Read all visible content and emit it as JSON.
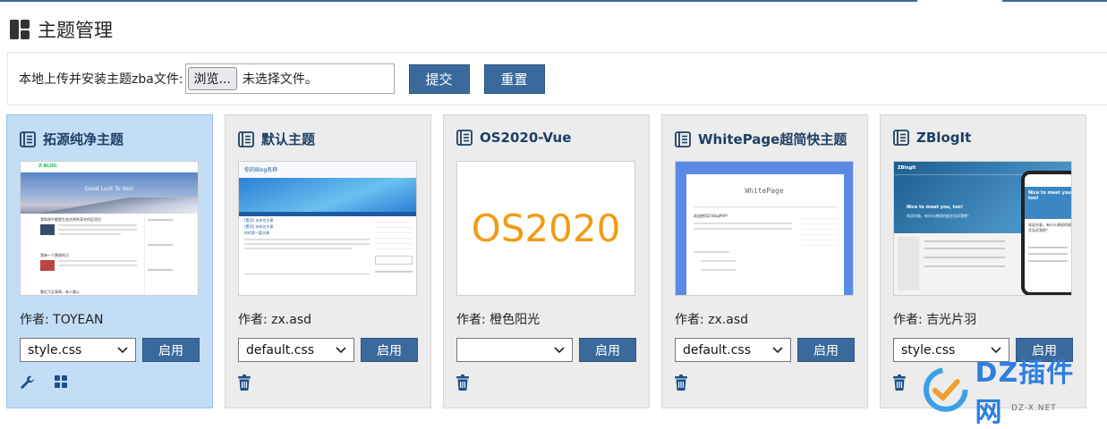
{
  "header": {
    "title": "主题管理",
    "icon": "layout-icon"
  },
  "upload": {
    "label": "本地上传并安装主题zba文件:",
    "browse_label": "浏览...",
    "file_status": "未选择文件。",
    "submit_label": "提交",
    "reset_label": "重置"
  },
  "colors": {
    "accent": "#3a6a9c",
    "active_card": "#c3ddf6",
    "card_bg": "#ececec"
  },
  "themes": [
    {
      "name": "拓源纯净主题",
      "author_prefix": "作者:",
      "author": "TOYEAN",
      "style": "style.css",
      "enable_label": "启用",
      "active": true,
      "preview": {
        "logo": "Z-BLOG",
        "banner": "Good Luck To You!",
        "post1": "我和南平都是生态文明共享合作区项目",
        "post2": "我每一个黄昏的日",
        "post3": "靠近乃至高原，有人路心"
      }
    },
    {
      "name": "默认主题",
      "author_prefix": "作者:",
      "author": "zx.asd",
      "style": "default.css",
      "enable_label": "启用",
      "active": false,
      "preview": {
        "site_title": "你的Blog名称",
        "post1": "[置顶] 未命名文章",
        "post2": "[置顶] 未命名文章",
        "post3": "你的第一篇文章"
      }
    },
    {
      "name": "OS2020-Vue",
      "author_prefix": "作者:",
      "author": "橙色阳光",
      "style": "",
      "enable_label": "启用",
      "active": false,
      "preview": {
        "logo_text": "OS2020"
      }
    },
    {
      "name": "WhitePage超简快主题",
      "author_prefix": "作者:",
      "author": "zx.asd",
      "style": "default.css",
      "enable_label": "启用",
      "active": false,
      "preview": {
        "site_title": "WhitePage",
        "post1": "欢迎使用Z-BlogPHP!"
      }
    },
    {
      "name": "ZBlogIt",
      "author_prefix": "作者:",
      "author": "吉光片羽",
      "style": "style.css",
      "enable_label": "启用",
      "active": false,
      "preview": {
        "brand": "ZBlogIt",
        "hero": "Nice to meet you, too!",
        "sub": "欢迎光临，有什么想说的留言告诉我吧！",
        "phone_hero": "Nice to meet you, too!",
        "phone_sub": "欢迎光临，有什么想说的留言告诉我吧！"
      }
    }
  ],
  "watermark": {
    "text": "DZ插件网",
    "domain": "DZ-X.NET"
  }
}
